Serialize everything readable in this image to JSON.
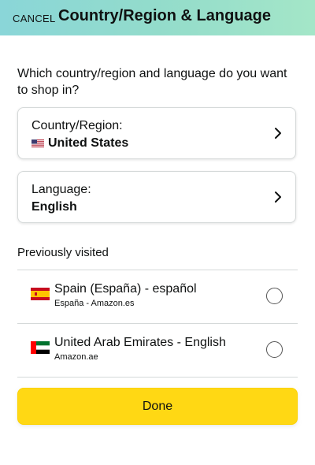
{
  "header": {
    "cancel_label": "CANCEL",
    "title": "Country/Region & Language"
  },
  "question": "Which country/region and language do you want to shop in?",
  "country": {
    "label": "Country/Region:",
    "value": "United States",
    "flag_icon": "us-flag-icon"
  },
  "language": {
    "label": "Language:",
    "value": "English"
  },
  "previously_visited": {
    "heading": "Previously visited",
    "items": [
      {
        "title": "Spain (España) - español",
        "subtitle": "España - Amazon.es",
        "flag_icon": "spain-flag-icon",
        "selected": false
      },
      {
        "title": "United Arab Emirates - English",
        "subtitle": "Amazon.ae",
        "flag_icon": "uae-flag-icon",
        "selected": false
      }
    ]
  },
  "done_label": "Done",
  "colors": {
    "header_gradient_start": "#8ad6d8",
    "header_gradient_end": "#a4e6c8",
    "done_button": "#ffd814",
    "divider": "#d5d9d9"
  }
}
